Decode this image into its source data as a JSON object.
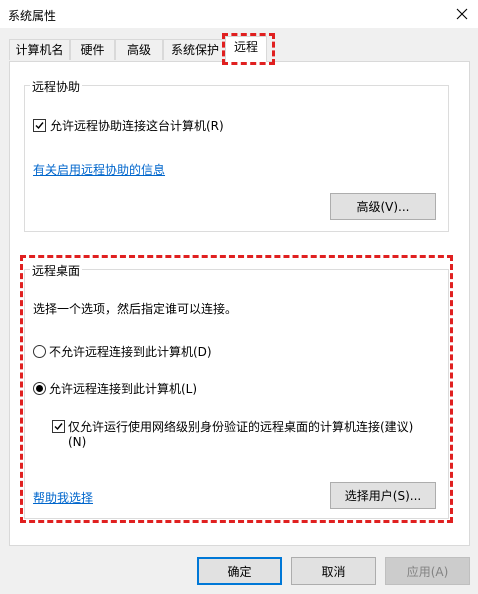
{
  "window": {
    "title": "系统属性"
  },
  "tabs": [
    {
      "label": "计算机名"
    },
    {
      "label": "硬件"
    },
    {
      "label": "高级"
    },
    {
      "label": "系统保护"
    },
    {
      "label": "远程"
    }
  ],
  "remote_assistance": {
    "group_label": "远程协助",
    "allow_checkbox": {
      "label": "允许远程协助连接这台计算机(R)",
      "checked": true
    },
    "info_link": "有关启用远程协助的信息",
    "advanced_button": "高级(V)..."
  },
  "remote_desktop": {
    "group_label": "远程桌面",
    "instruction": "选择一个选项，然后指定谁可以连接。",
    "option_disallow": {
      "label": "不允许远程连接到此计算机(D)",
      "selected": false
    },
    "option_allow": {
      "label": "允许远程连接到此计算机(L)",
      "selected": true
    },
    "nla_checkbox": {
      "line1": "仅允许运行使用网络级别身份验证的远程桌面的计算机连接(建议)",
      "line2": "(N)",
      "checked": true
    },
    "help_link": "帮助我选择",
    "select_users_button": "选择用户(S)..."
  },
  "footer": {
    "ok": "确定",
    "cancel": "取消",
    "apply": "应用(A)"
  },
  "colors": {
    "highlight": "#e02020",
    "link": "#0066cc",
    "default_button_border": "#0078d7"
  }
}
